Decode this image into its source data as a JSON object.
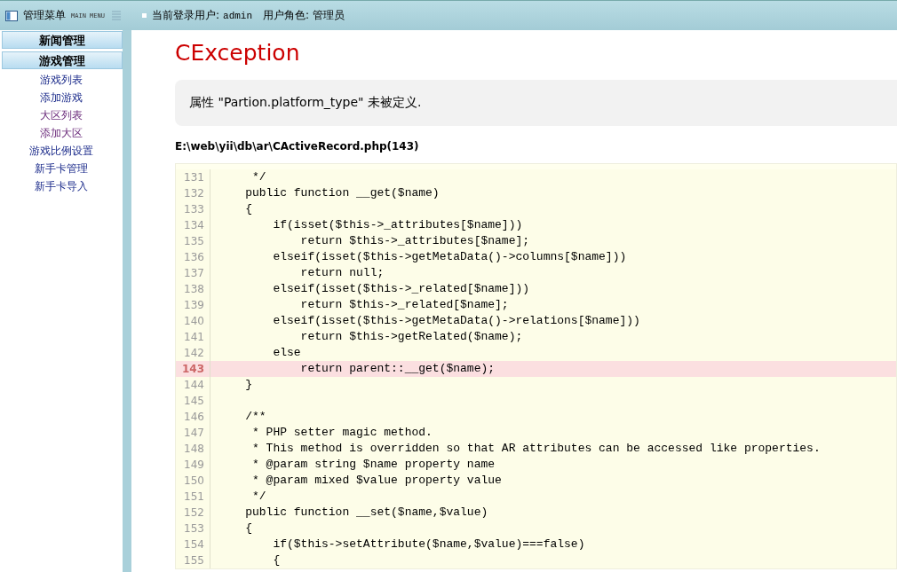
{
  "header": {
    "menu_title": "管理菜单",
    "menu_subtitle": "MAIN MENU",
    "user_label": "当前登录用户:",
    "user_name": "admin",
    "role_label": "用户角色:",
    "role_name": "管理员"
  },
  "sidebar": {
    "sections": [
      {
        "label": "新闻管理"
      },
      {
        "label": "游戏管理",
        "items": [
          {
            "label": "游戏列表",
            "visited": false
          },
          {
            "label": "添加游戏",
            "visited": false
          },
          {
            "label": "大区列表",
            "visited": true
          },
          {
            "label": "添加大区",
            "visited": true
          },
          {
            "label": "游戏比例设置",
            "visited": false
          },
          {
            "label": "新手卡管理",
            "visited": false
          },
          {
            "label": "新手卡导入",
            "visited": false
          }
        ]
      }
    ]
  },
  "error": {
    "title": "CException",
    "message": "属性 \"Partion.platform_type\" 未被定义.",
    "file": "E:\\web\\yii\\db\\ar\\CActiveRecord.php(143)"
  },
  "source": {
    "lines": [
      {
        "number": "131",
        "code": "     */",
        "highlighted": false
      },
      {
        "number": "132",
        "code": "    public function __get($name)",
        "highlighted": false
      },
      {
        "number": "133",
        "code": "    {",
        "highlighted": false
      },
      {
        "number": "134",
        "code": "        if(isset($this->_attributes[$name]))",
        "highlighted": false
      },
      {
        "number": "135",
        "code": "            return $this->_attributes[$name];",
        "highlighted": false
      },
      {
        "number": "136",
        "code": "        elseif(isset($this->getMetaData()->columns[$name]))",
        "highlighted": false
      },
      {
        "number": "137",
        "code": "            return null;",
        "highlighted": false
      },
      {
        "number": "138",
        "code": "        elseif(isset($this->_related[$name]))",
        "highlighted": false
      },
      {
        "number": "139",
        "code": "            return $this->_related[$name];",
        "highlighted": false
      },
      {
        "number": "140",
        "code": "        elseif(isset($this->getMetaData()->relations[$name]))",
        "highlighted": false
      },
      {
        "number": "141",
        "code": "            return $this->getRelated($name);",
        "highlighted": false
      },
      {
        "number": "142",
        "code": "        else",
        "highlighted": false
      },
      {
        "number": "143",
        "code": "            return parent::__get($name);",
        "highlighted": true
      },
      {
        "number": "144",
        "code": "    }",
        "highlighted": false
      },
      {
        "number": "145",
        "highlighted": false
      },
      {
        "number": "146",
        "code": "    /**",
        "highlighted": false
      },
      {
        "number": "147",
        "code": "     * PHP setter magic method.",
        "highlighted": false
      },
      {
        "number": "148",
        "code": "     * This method is overridden so that AR attributes can be accessed like properties.",
        "highlighted": false
      },
      {
        "number": "149",
        "code": "     * @param string $name property name",
        "highlighted": false
      },
      {
        "number": "150",
        "code": "     * @param mixed $value property value",
        "highlighted": false
      },
      {
        "number": "151",
        "code": "     */",
        "highlighted": false
      },
      {
        "number": "152",
        "code": "    public function __set($name,$value)",
        "highlighted": false
      },
      {
        "number": "153",
        "code": "    {",
        "highlighted": false
      },
      {
        "number": "154",
        "code": "        if($this->setAttribute($name,$value)===false)",
        "highlighted": false
      },
      {
        "number": "155",
        "code": "        {",
        "highlighted": false
      }
    ]
  }
}
